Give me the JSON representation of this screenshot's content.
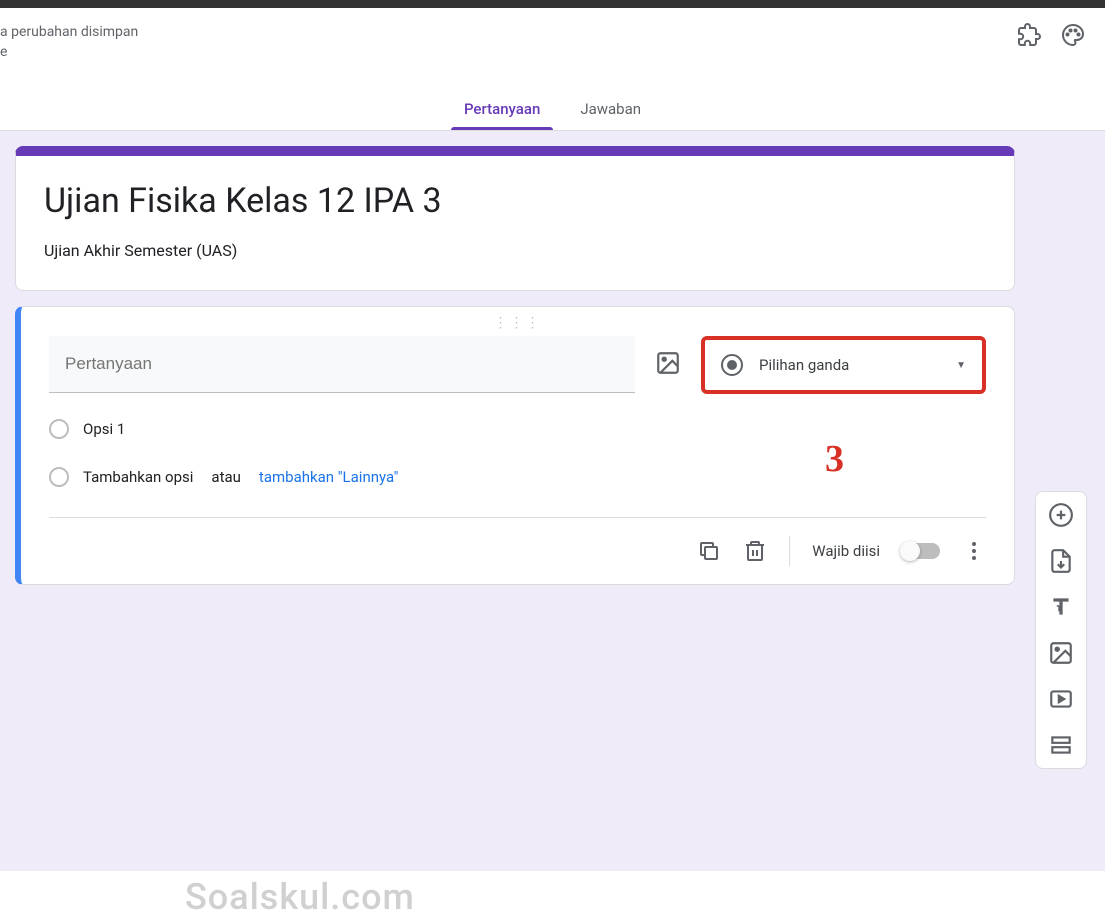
{
  "header": {
    "save_status_line1": "a perubahan disimpan",
    "save_status_line2": "e"
  },
  "tabs": {
    "questions": "Pertanyaan",
    "responses": "Jawaban"
  },
  "form": {
    "title": "Ujian Fisika Kelas 12 IPA 3",
    "description": "Ujian Akhir Semester (UAS)"
  },
  "question": {
    "placeholder": "Pertanyaan",
    "type_label": "Pilihan ganda",
    "option1": "Opsi 1",
    "add_option": "Tambahkan opsi",
    "or_text": "atau",
    "add_other": "tambahkan \"Lainnya\"",
    "required_label": "Wajib diisi"
  },
  "annotation": "3",
  "watermark": "Soalskul.com"
}
